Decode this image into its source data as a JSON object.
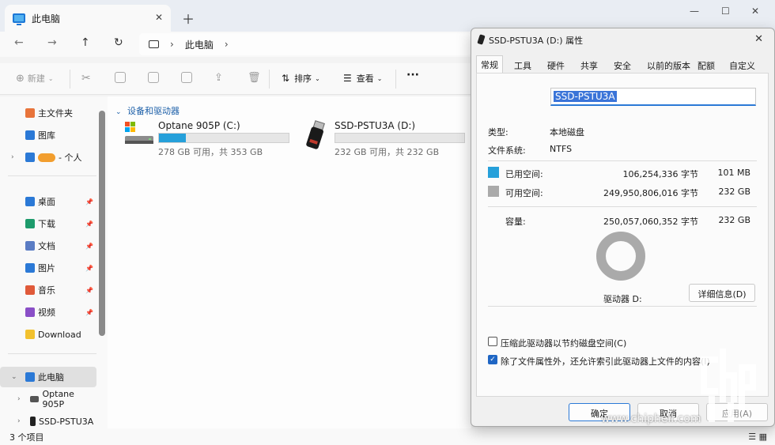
{
  "explorer": {
    "tab_title": "此电脑",
    "address": {
      "segment": "此电脑"
    },
    "toolbar": {
      "new_label": "新建",
      "sort_label": "排序",
      "view_label": "查看",
      "more_label": "···"
    },
    "sidebar": {
      "items": [
        {
          "label": "主文件夹",
          "color": "#e8743b"
        },
        {
          "label": "图库",
          "color": "#2b79d6"
        },
        {
          "label": "- 个人",
          "color": "#f29e2e"
        },
        {
          "label": "桌面",
          "color": "#2b79d6"
        },
        {
          "label": "下载",
          "color": "#1d9b6c"
        },
        {
          "label": "文档",
          "color": "#5a7cc4"
        },
        {
          "label": "图片",
          "color": "#2b79d6"
        },
        {
          "label": "音乐",
          "color": "#e05a3a"
        },
        {
          "label": "视频",
          "color": "#8a4fc7"
        },
        {
          "label": "Download",
          "color": "#f2c12e"
        },
        {
          "label": "此电脑",
          "color": "#2b79d6"
        },
        {
          "label": "Optane 905P",
          "color": "#555555"
        },
        {
          "label": "SSD-PSTU3A",
          "color": "#222222"
        }
      ]
    },
    "group_header": "设备和驱动器",
    "drives": [
      {
        "name": "Optane 905P (C:)",
        "free_text": "278 GB 可用，共 353 GB",
        "used_fraction": 0.21
      },
      {
        "name": "SSD-PSTU3A (D:)",
        "free_text": "232 GB 可用，共 232 GB",
        "used_fraction": 0.0
      }
    ],
    "status_text": "3 个项目"
  },
  "dialog": {
    "title": "SSD-PSTU3A (D:) 属性",
    "tabs": [
      "常规",
      "工具",
      "硬件",
      "共享",
      "安全",
      "以前的版本",
      "配额",
      "自定义"
    ],
    "volume_name": "SSD-PSTU3A",
    "type_label": "类型:",
    "type_value": "本地磁盘",
    "fs_label": "文件系统:",
    "fs_value": "NTFS",
    "used_label": "已用空间:",
    "used_bytes": "106,254,336 字节",
    "used_size": "101 MB",
    "free_label": "可用空间:",
    "free_bytes": "249,950,806,016 字节",
    "free_size": "232 GB",
    "capacity_label": "容量:",
    "capacity_bytes": "250,057,060,352 字节",
    "capacity_size": "232 GB",
    "used_color": "#26a0da",
    "free_color": "#aaaaaa",
    "drive_label": "驱动器 D:",
    "details_button": "详细信息(D)",
    "compress_label": "压缩此驱动器以节约磁盘空间(C)",
    "index_label": "除了文件属性外，还允许索引此驱动器上文件的内容(I)",
    "compress_checked": false,
    "index_checked": true,
    "ok_button": "确定",
    "cancel_button": "取消",
    "apply_button": "应用(A)"
  },
  "watermark": {
    "url": "www.chiphell.com"
  }
}
